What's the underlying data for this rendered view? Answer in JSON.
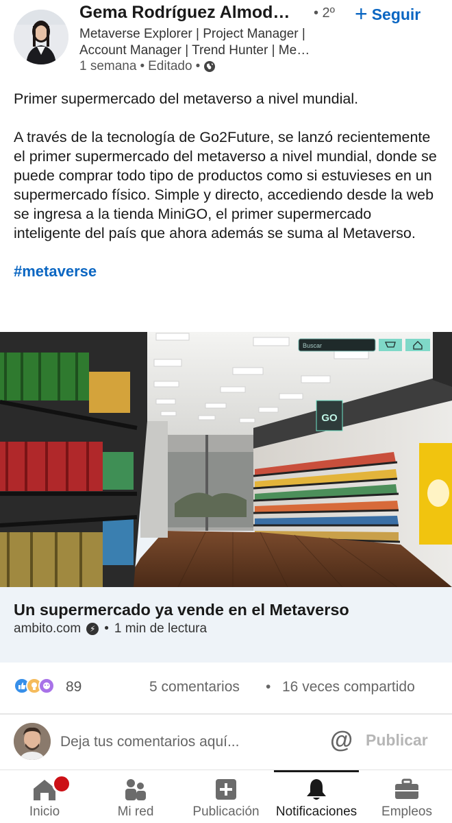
{
  "post": {
    "author_name": "Gema Rodríguez Almod…",
    "degree": "• 2º",
    "follow_label": "Seguir",
    "headline": "Metaverse Explorer | Project Manager | Account Manager | Trend Hunter | Me…",
    "time": "1 semana",
    "edited": "Editado",
    "body_line1": "Primer supermercado del metaverso a nivel mundial.",
    "body_line2": "A través de la tecnología de Go2Future, se lanzó recientemente el primer supermercado del metaverso a nivel mundial, donde se puede comprar todo tipo de productos como si estuvieses en un supermercado físico. Simple y directo, accediendo desde la web se ingresa a la tienda MiniGO, el primer supermercado inteligente del país que ahora además se suma al Metaverso.",
    "hashtag": "#metaverse"
  },
  "card": {
    "title": "Un supermercado ya vende en el Metaverso",
    "source": "ambito.com",
    "read_time": "1 min de lectura",
    "image_search_placeholder": "Buscar",
    "image_store_sign": "GO"
  },
  "social": {
    "reaction_count": "89",
    "comments": "5 comentarios",
    "separator": "•",
    "shares": "16 veces compartido"
  },
  "comment": {
    "placeholder": "Deja tus comentarios aquí...",
    "publish_label": "Publicar"
  },
  "nav": {
    "items": [
      {
        "label": "Inicio",
        "icon": "home-icon"
      },
      {
        "label": "Mi red",
        "icon": "network-icon"
      },
      {
        "label": "Publicación",
        "icon": "post-icon"
      },
      {
        "label": "Notificaciones",
        "icon": "bell-icon"
      },
      {
        "label": "Empleos",
        "icon": "briefcase-icon"
      }
    ],
    "active": "Notificaciones"
  },
  "colors": {
    "brand": "#0a66c2",
    "card_bg": "#eef3f8",
    "badge": "#cc1016",
    "muted": "#666666"
  }
}
